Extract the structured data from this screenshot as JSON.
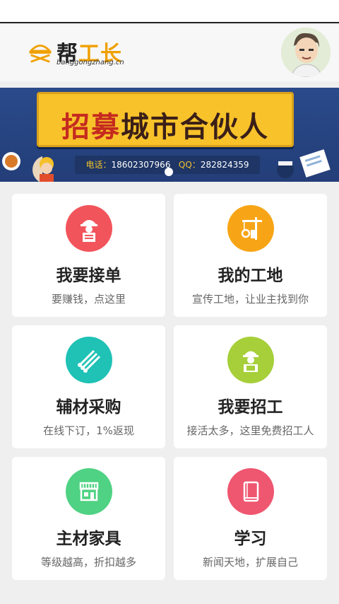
{
  "header": {
    "logo_title_a": "帮",
    "logo_title_b": "工长",
    "logo_sub": "banggongzhang.cn"
  },
  "banner": {
    "title_a": "招募",
    "title_b": "城市合伙人",
    "phone_label": "电话：",
    "phone": "18602307966",
    "qq_label": "QQ：",
    "qq": "282824359"
  },
  "tiles": [
    {
      "title": "我要接单",
      "sub": "要赚钱，点这里",
      "color": "#f2545b",
      "icon": "worker-document-icon"
    },
    {
      "title": "我的工地",
      "sub": "宣传工地，让业主找到你",
      "color": "#f7a516",
      "icon": "crane-icon"
    },
    {
      "title": "辅材采购",
      "sub": "在线下订，1%返现",
      "color": "#1fc2b5",
      "icon": "pipes-icon"
    },
    {
      "title": "我要招工",
      "sub": "接活太多，这里免费招工人",
      "color": "#a6cf3a",
      "icon": "worker-laptop-icon"
    },
    {
      "title": "主材家具",
      "sub": "等级越高，折扣越多",
      "color": "#4fd283",
      "icon": "shop-icon"
    },
    {
      "title": "学习",
      "sub": "新闻天地，扩展自己",
      "color": "#ef5670",
      "icon": "book-icon"
    }
  ]
}
